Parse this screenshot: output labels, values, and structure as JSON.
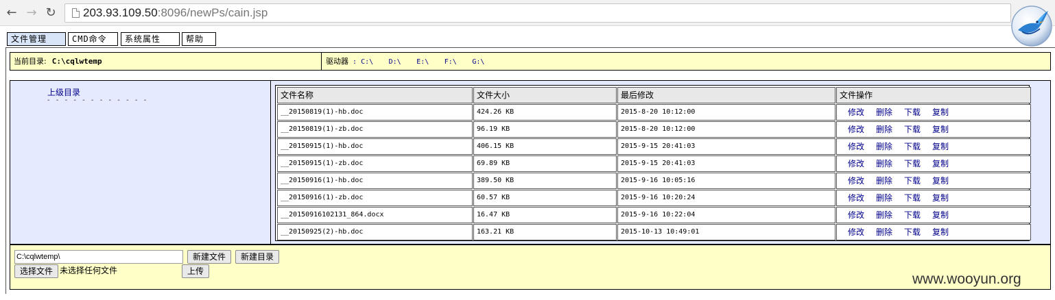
{
  "browser": {
    "url_host": "203.93.109.50",
    "url_rest": ":8096/newPs/cain.jsp"
  },
  "menu": {
    "file_mgmt": "文件管理",
    "cmd": "CMD命令",
    "sys_props": "系统属性",
    "help": "帮助"
  },
  "path_bar": {
    "current_label": "当前目录:",
    "current_value": "C:\\cqlwtemp",
    "drives_label": "驱动器",
    "drives_colon": " : ",
    "drives": [
      "C:\\",
      "D:\\",
      "E:\\",
      "F:\\",
      "G:\\"
    ]
  },
  "left_panel": {
    "up_dir": "上级目录",
    "dashes": "- - - - - - - - - - - -"
  },
  "table": {
    "headers": [
      "文件名称",
      "文件大小",
      "最后修改",
      "文件操作"
    ],
    "ops": [
      "修改",
      "删除",
      "下载",
      "复制"
    ],
    "rows": [
      {
        "name": "__20150819(1)-hb.doc",
        "size": "424.26 KB",
        "modified": "2015-8-20 10:12:00"
      },
      {
        "name": "__20150819(1)-zb.doc",
        "size": "96.19 KB",
        "modified": "2015-8-20 10:12:00"
      },
      {
        "name": "__20150915(1)-hb.doc",
        "size": "406.15 KB",
        "modified": "2015-9-15 20:41:03"
      },
      {
        "name": "__20150915(1)-zb.doc",
        "size": "69.89 KB",
        "modified": "2015-9-15 20:41:03"
      },
      {
        "name": "__20150916(1)-hb.doc",
        "size": "389.50 KB",
        "modified": "2015-9-16 10:05:16"
      },
      {
        "name": "__20150916(1)-zb.doc",
        "size": "60.57 KB",
        "modified": "2015-9-16 10:20:24"
      },
      {
        "name": "__20150916102131_864.docx",
        "size": "16.47 KB",
        "modified": "2015-9-16 10:22:04"
      },
      {
        "name": "__20150925(2)-hb.doc",
        "size": "163.21 KB",
        "modified": "2015-10-13 10:49:01"
      }
    ]
  },
  "bottom": {
    "path_value": "C:\\cqlwtemp\\",
    "new_file": "新建文件",
    "new_dir": "新建目录",
    "choose_file": "选择文件",
    "no_file": "未选择任何文件",
    "upload": "上传"
  },
  "watermark": "www.wooyun.org",
  "colors": {
    "path_bg": "#ffffc8",
    "panel_bg": "#e6eaff",
    "link": "#00008b"
  }
}
